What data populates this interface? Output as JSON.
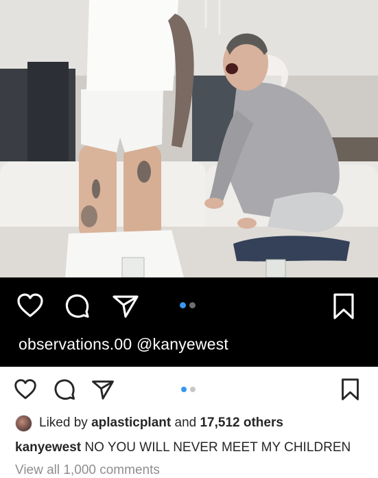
{
  "post": {
    "photo_alt": "",
    "dark_overlay": {
      "caption": "observations.00 @kanyewest",
      "carousel_dots": [
        {
          "active": true,
          "color": "#3897f0"
        },
        {
          "active": false,
          "color": "#6e6e6e"
        }
      ]
    },
    "actions": {
      "like_icon": "heart-icon",
      "comment_icon": "comment-icon",
      "share_icon": "send-icon",
      "save_icon": "bookmark-icon"
    },
    "carousel_dots": [
      {
        "active": true,
        "color": "#3897f0"
      },
      {
        "active": false,
        "color": "#c7c7c7"
      }
    ],
    "likes": {
      "prefix": "Liked by",
      "user": "aplasticplant",
      "conjunction": "and",
      "count": "17,512 others"
    },
    "caption": {
      "username": "kanyewest",
      "text": "NO YOU WILL NEVER MEET MY CHILDREN"
    },
    "view_comments": "View all 1,000 comments"
  },
  "colors": {
    "accent_blue": "#3897f0",
    "text_dark": "#262626",
    "text_muted": "#8e8e8e",
    "dark_band": "#000000"
  }
}
